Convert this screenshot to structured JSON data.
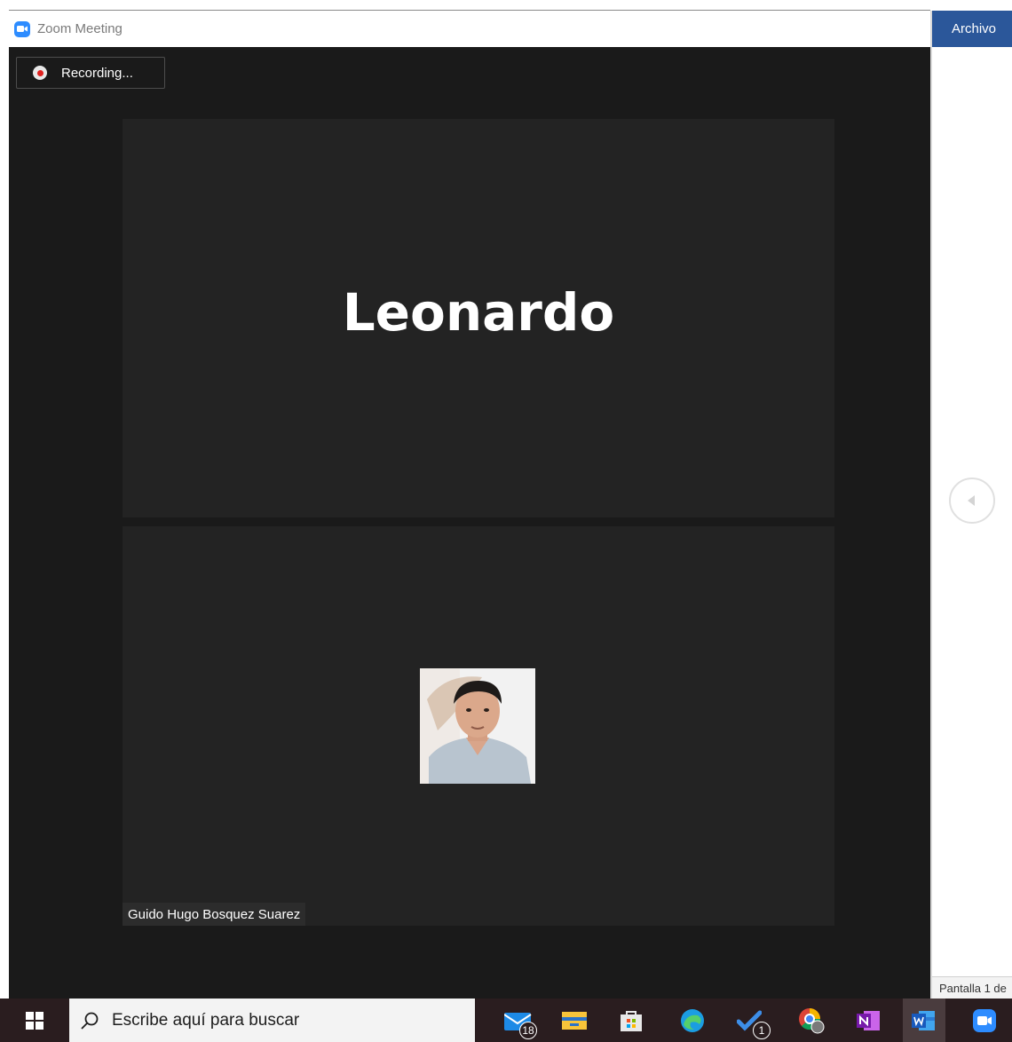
{
  "zoom": {
    "title": "Zoom Meeting",
    "recording_label": "Recording...",
    "speaker_name": "Leonardo",
    "participant_name": "Guido Hugo Bosquez Suarez",
    "accent_color": "#2d8cff"
  },
  "word": {
    "tab_label": "Archivo",
    "status_text": "Pantalla 1 de",
    "accent_color": "#2b579a"
  },
  "taskbar": {
    "search_placeholder": "Escribe aquí para buscar",
    "apps": [
      {
        "name": "mail-icon",
        "badge": "18"
      },
      {
        "name": "file-explorer-icon",
        "badge": ""
      },
      {
        "name": "store-icon",
        "badge": ""
      },
      {
        "name": "edge-icon",
        "badge": ""
      },
      {
        "name": "todo-icon",
        "badge": "1"
      },
      {
        "name": "chrome-profile-icon",
        "badge": ""
      },
      {
        "name": "onenote-icon",
        "badge": ""
      },
      {
        "name": "word-icon",
        "badge": ""
      },
      {
        "name": "zoom-icon",
        "badge": ""
      }
    ]
  }
}
